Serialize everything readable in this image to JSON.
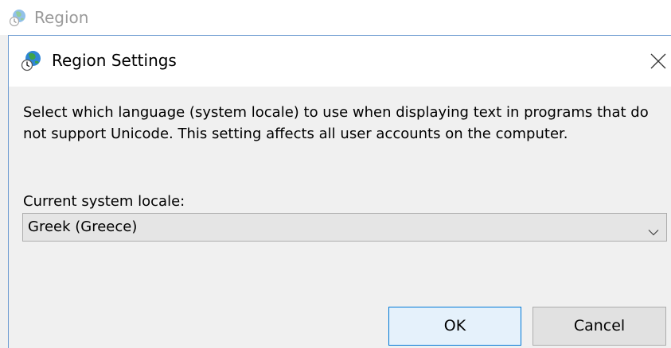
{
  "parent_window": {
    "title": "Region",
    "icon": "globe-clock-icon"
  },
  "dialog": {
    "title": "Region Settings",
    "icon": "globe-clock-icon",
    "close_icon": "close-icon",
    "description": "Select which language (system locale) to use when displaying text in programs that do not support Unicode. This setting affects all user accounts on the computer.",
    "locale_label": "Current system locale:",
    "locale_select": {
      "selected": "Greek (Greece)",
      "icon": "chevron-down-icon"
    },
    "buttons": {
      "ok_label": "OK",
      "cancel_label": "Cancel"
    }
  },
  "colors": {
    "accent": "#0078d7",
    "dialog_border": "#6d9bd1",
    "background": "#f0f0f0"
  }
}
